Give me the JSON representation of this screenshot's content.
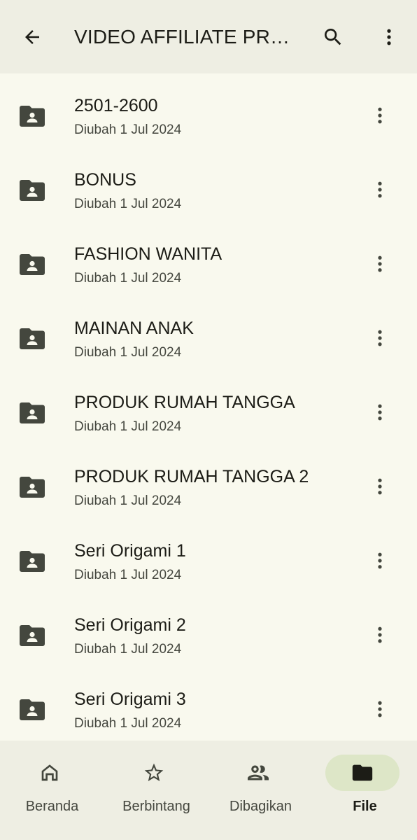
{
  "topbar": {
    "title": "VIDEO AFFILIATE PRO...",
    "back_icon": "arrow-left-icon",
    "search_icon": "search-icon",
    "more_icon": "more-vertical-icon"
  },
  "folders": [
    {
      "name": "2501-2600",
      "modified": "Diubah 1 Jul 2024"
    },
    {
      "name": "BONUS",
      "modified": "Diubah 1 Jul 2024"
    },
    {
      "name": "FASHION WANITA",
      "modified": "Diubah 1 Jul 2024"
    },
    {
      "name": "MAINAN ANAK",
      "modified": "Diubah 1 Jul 2024"
    },
    {
      "name": "PRODUK RUMAH TANGGA",
      "modified": "Diubah 1 Jul 2024"
    },
    {
      "name": "PRODUK RUMAH TANGGA 2",
      "modified": "Diubah 1 Jul 2024"
    },
    {
      "name": "Seri Origami 1",
      "modified": "Diubah 1 Jul 2024"
    },
    {
      "name": "Seri Origami 2",
      "modified": "Diubah 1 Jul 2024"
    },
    {
      "name": "Seri Origami 3",
      "modified": "Diubah 1 Jul 2024"
    }
  ],
  "bottom_nav": {
    "items": [
      {
        "label": "Beranda",
        "icon": "home-icon",
        "active": false
      },
      {
        "label": "Berbintang",
        "icon": "star-icon",
        "active": false
      },
      {
        "label": "Dibagikan",
        "icon": "people-icon",
        "active": false
      },
      {
        "label": "File",
        "icon": "folder-icon",
        "active": true
      }
    ]
  },
  "colors": {
    "background": "#f9f9ee",
    "bar": "#eeeee3",
    "active_pill": "#dde6c7",
    "icon": "#44473e",
    "text": "#1c1c16"
  }
}
